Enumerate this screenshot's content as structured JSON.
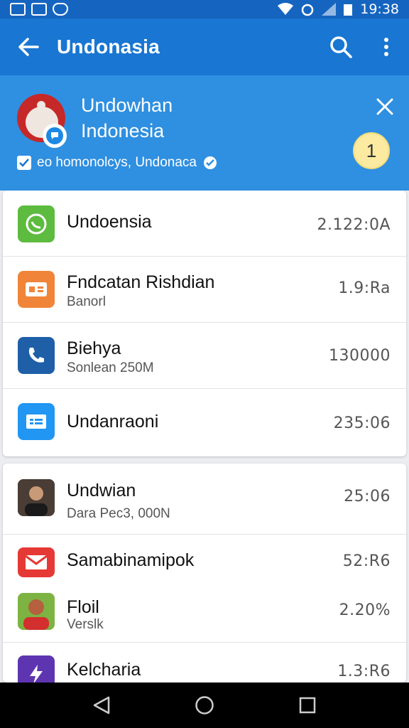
{
  "status_bar": {
    "time": "19:38"
  },
  "app_bar": {
    "title": "Undonasia"
  },
  "banner": {
    "name_line1": "Undowhan",
    "name_line2": "Indonesia",
    "subtitle": "eo homonolcys, Undonaca",
    "unread_count": "1"
  },
  "list_group1": [
    {
      "title": "Undoensia",
      "subtitle": "",
      "value": "2.122:0A",
      "icon": "whatsapp-icon",
      "color": "#5dbb3f"
    },
    {
      "title": "Fndcatan Rishdian",
      "subtitle": "Banorl",
      "value": "1.9:Ra",
      "icon": "card-icon",
      "color": "#f0853a"
    },
    {
      "title": "Biehya",
      "subtitle": "Sonlean 250M",
      "value": "130000",
      "icon": "phone-icon",
      "color": "#1e5fa8"
    },
    {
      "title": "Undanraoni",
      "subtitle": "",
      "value": "235:06",
      "icon": "message-icon",
      "color": "#2196f3"
    }
  ],
  "list_group2": [
    {
      "title": "Undwian",
      "subtitle": "Dara Pec3, 000N",
      "value": "25:06",
      "icon": "person-photo-icon",
      "color": "#3a3a3a"
    },
    {
      "title": "Samabinamipok",
      "subtitle": "",
      "value": "52:R6",
      "icon": "mail-icon",
      "color": "#e53935"
    },
    {
      "title": "Floil",
      "subtitle": "Verslk",
      "value": "2.20%",
      "icon": "person-photo-icon",
      "color": "#8bc34a"
    },
    {
      "title": "Kelcharia",
      "subtitle": "",
      "value": "1.3:R6",
      "icon": "bolt-icon",
      "color": "#5e35b1"
    }
  ]
}
